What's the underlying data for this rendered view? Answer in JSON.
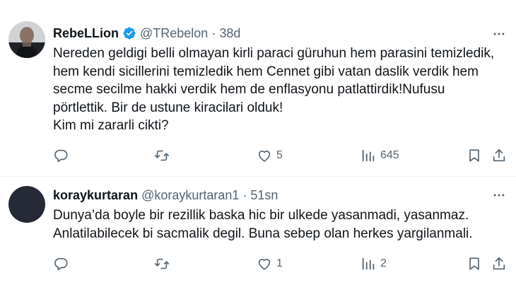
{
  "tweets": [
    {
      "author_name": "RebeLLion",
      "handle": "@TRebelon",
      "separator": "·",
      "time": "38d",
      "verified": true,
      "text_lines": [
        "Nereden geldigi belli olmayan kirli paraci güruhun hem parasini temizledik,",
        "hem kendi sicillerini temizledik hem Cennet gibi vatan daslik verdik hem",
        "secme secilme hakki verdik hem de enflasyonu patlattirdik!Nufusu",
        "pörtlettik. Bir de ustune kiracilari olduk!",
        "Kim mi zararli cikti?"
      ],
      "reply_count": "",
      "retweet_count": "",
      "like_count": "5",
      "view_count": "645"
    },
    {
      "author_name": "koraykurtaran",
      "handle": "@koraykurtaran1",
      "separator": "·",
      "time": "51sn",
      "verified": false,
      "text_lines": [
        "Dunya’da boyle bir rezillik baska hic bir ulkede yasanmadi, yasanmaz.",
        "Anlatilabilecek bi sacmalik degil. Buna sebep olan herkes yargilanmali."
      ],
      "reply_count": "",
      "retweet_count": "",
      "like_count": "1",
      "view_count": "2"
    }
  ],
  "icons": {
    "verified": "verified-badge-icon",
    "more": "more-horizontal-icon",
    "reply": "reply-icon",
    "retweet": "retweet-icon",
    "like": "heart-icon",
    "views": "views-icon",
    "bookmark": "bookmark-icon",
    "share": "share-icon"
  },
  "colors": {
    "text": "#0f1419",
    "muted": "#536471",
    "verified": "#1d9bf0",
    "divider": "#eff3f4"
  }
}
